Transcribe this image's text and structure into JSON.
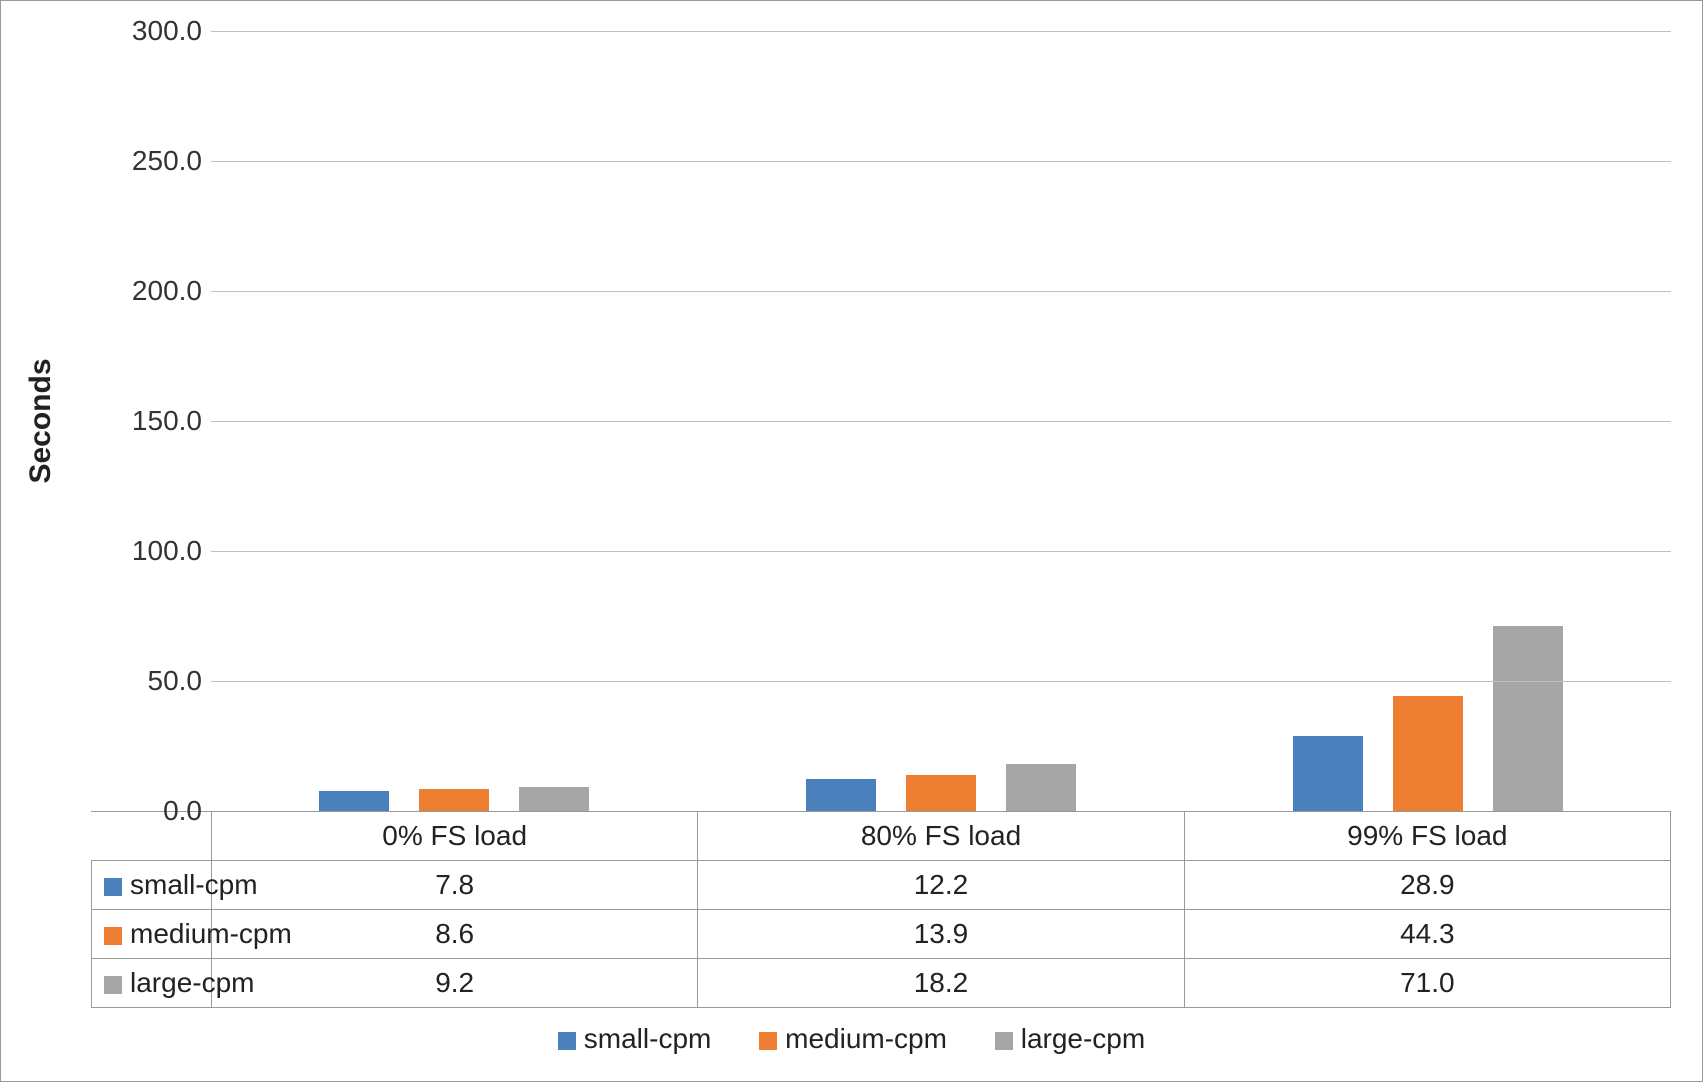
{
  "chart_data": {
    "type": "bar",
    "ylabel": "Seconds",
    "ylim": [
      0,
      300
    ],
    "yticks": [
      "0.0",
      "50.0",
      "100.0",
      "150.0",
      "200.0",
      "250.0",
      "300.0"
    ],
    "categories": [
      "0% FS load",
      "80% FS load",
      "99% FS load"
    ],
    "series": [
      {
        "name": "small-cpm",
        "color": "#4a81bd",
        "values": [
          7.8,
          12.2,
          28.9
        ]
      },
      {
        "name": "medium-cpm",
        "color": "#ed7d31",
        "values": [
          8.6,
          13.9,
          44.3
        ]
      },
      {
        "name": "large-cpm",
        "color": "#a6a6a6",
        "values": [
          9.2,
          18.2,
          71.0
        ]
      }
    ]
  },
  "table": {
    "rows": [
      {
        "label": "small-cpm",
        "swatch": "#4a81bd",
        "cells": [
          "7.8",
          "12.2",
          "28.9"
        ]
      },
      {
        "label": "medium-cpm",
        "swatch": "#ed7d31",
        "cells": [
          "8.6",
          "13.9",
          "44.3"
        ]
      },
      {
        "label": "large-cpm",
        "swatch": "#a6a6a6",
        "cells": [
          "9.2",
          "18.2",
          "71.0"
        ]
      }
    ],
    "headers": [
      "0% FS load",
      "80% FS load",
      "99% FS load"
    ]
  },
  "legend": {
    "items": [
      {
        "label": "small-cpm",
        "swatch": "#4a81bd"
      },
      {
        "label": "medium-cpm",
        "swatch": "#ed7d31"
      },
      {
        "label": "large-cpm",
        "swatch": "#a6a6a6"
      }
    ]
  }
}
